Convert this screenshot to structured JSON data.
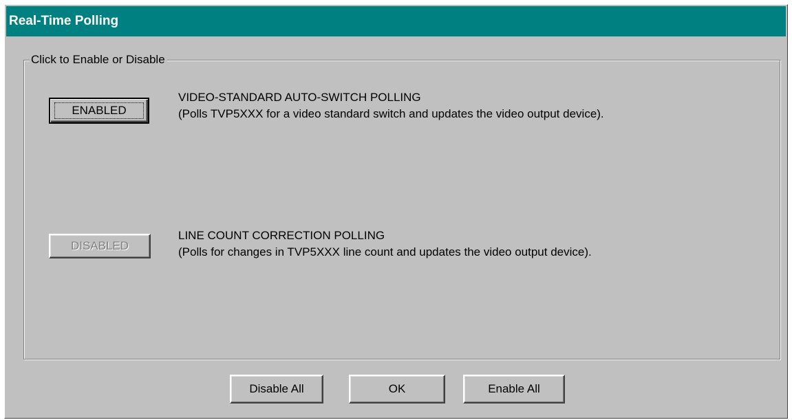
{
  "window": {
    "title": "Real-Time Polling"
  },
  "group": {
    "label": "Click to Enable or Disable"
  },
  "options": [
    {
      "button_label": "ENABLED",
      "state": "enabled",
      "title": "VIDEO-STANDARD AUTO-SWITCH POLLING",
      "description": "(Polls TVP5XXX for a video standard switch and updates the video output device)."
    },
    {
      "button_label": "DISABLED",
      "state": "disabled",
      "title": "LINE COUNT CORRECTION POLLING",
      "description": "(Polls for changes in TVP5XXX line count and updates the video output device)."
    }
  ],
  "footer": {
    "disable_all_label": "Disable All",
    "ok_label": "OK",
    "enable_all_label": "Enable All"
  },
  "colors": {
    "titlebar": "#008080",
    "face": "#c0c0c0",
    "disabled_text": "#808080"
  }
}
